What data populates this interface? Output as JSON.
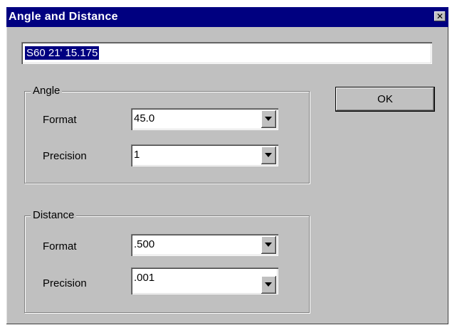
{
  "window": {
    "title": "Angle and Distance",
    "close_icon": "close-icon"
  },
  "readout": {
    "value": "S60 21' 15.175"
  },
  "angle": {
    "group_label": "Angle",
    "format_label": "Format",
    "format_value": "45.0",
    "precision_label": "Precision",
    "precision_value": "1"
  },
  "distance": {
    "group_label": "Distance",
    "format_label": "Format",
    "format_value": ".500",
    "precision_label": "Precision",
    "precision_value": ".001"
  },
  "buttons": {
    "ok_label": "OK"
  },
  "colors": {
    "titlebar": "#000080",
    "face": "#c0c0c0"
  }
}
